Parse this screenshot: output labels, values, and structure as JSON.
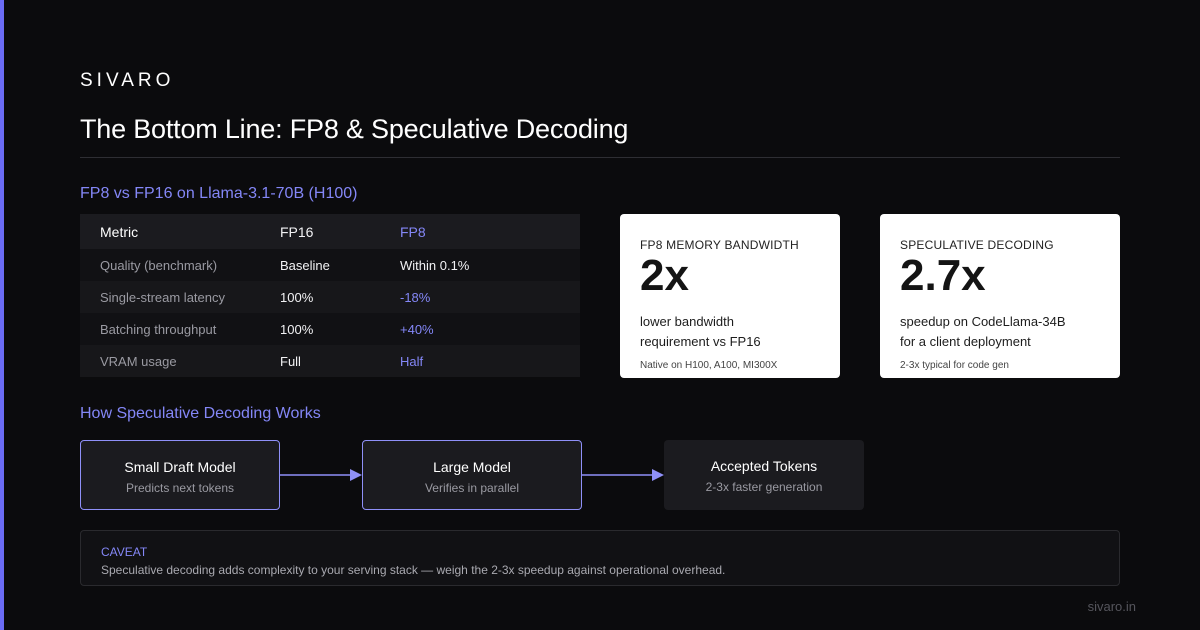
{
  "brand": "SIVARO",
  "title": "The Bottom Line: FP8 & Speculative Decoding",
  "comparison": {
    "heading": "FP8 vs FP16 on Llama-3.1-70B (H100)",
    "columns": [
      "Metric",
      "FP16",
      "FP8"
    ],
    "rows": [
      {
        "metric": "Quality (benchmark)",
        "fp16": "Baseline",
        "fp8": "Within 0.1%"
      },
      {
        "metric": "Single-stream latency",
        "fp16": "100%",
        "fp8": "-18%"
      },
      {
        "metric": "Batching throughput",
        "fp16": "100%",
        "fp8": "+40%"
      },
      {
        "metric": "VRAM usage",
        "fp16": "Full",
        "fp8": "Half"
      }
    ]
  },
  "stat_cards": [
    {
      "label": "FP8 MEMORY BANDWIDTH",
      "value": "2x",
      "desc_line1": "lower bandwidth",
      "desc_line2": "requirement vs FP16",
      "note": "Native on H100, A100, MI300X"
    },
    {
      "label": "SPECULATIVE DECODING",
      "value": "2.7x",
      "desc_line1": "speedup on CodeLlama-34B",
      "desc_line2": "for a client deployment",
      "note": "2-3x typical for code gen"
    }
  ],
  "flow": {
    "heading": "How Speculative Decoding Works",
    "steps": [
      {
        "title": "Small Draft Model",
        "subtitle": "Predicts next tokens"
      },
      {
        "title": "Large Model",
        "subtitle": "Verifies in parallel"
      },
      {
        "title": "Accepted Tokens",
        "subtitle": "2-3x faster generation"
      }
    ]
  },
  "caveat": {
    "label": "CAVEAT",
    "text": "Speculative decoding adds complexity to your serving stack — weigh the 2-3x speedup against operational overhead."
  },
  "footer": "sivaro.in",
  "colors": {
    "accent": "#6b6cf5",
    "highlight": "#8487f7",
    "background": "#0b0b0d",
    "card": "#ffffff"
  }
}
